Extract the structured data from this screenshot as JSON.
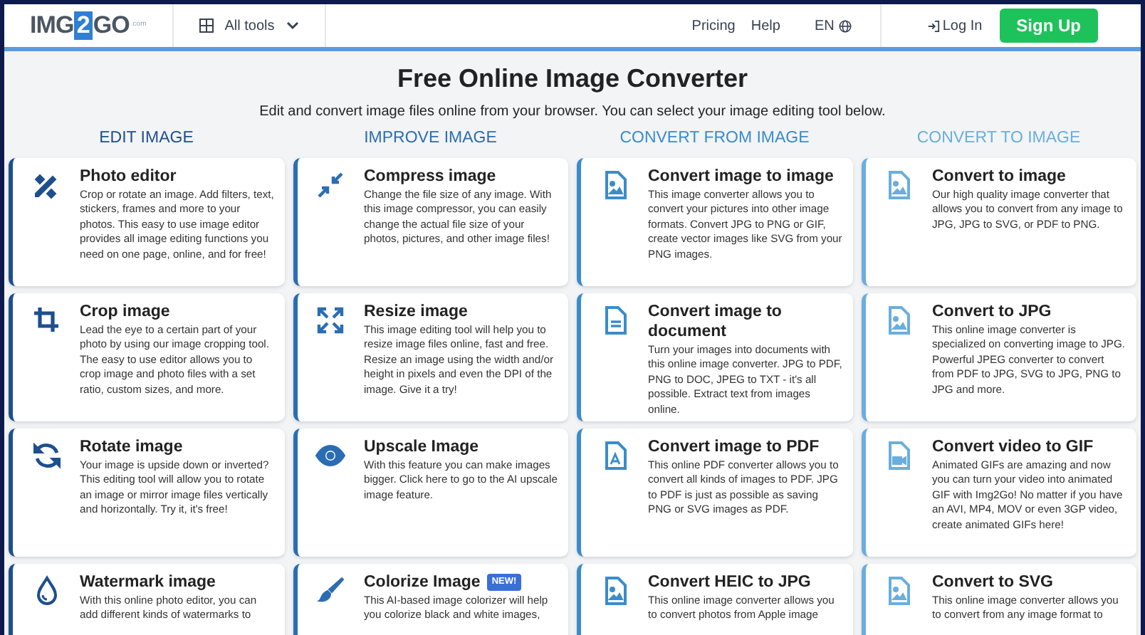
{
  "header": {
    "logo": {
      "left": "IMG",
      "digit": "2",
      "right": "GO",
      "suffix": ".com"
    },
    "all_tools": "All tools",
    "nav": [
      "Pricing",
      "Help"
    ],
    "language": "EN",
    "login": "Log In",
    "signup": "Sign Up"
  },
  "hero": {
    "title": "Free Online Image Converter",
    "subtitle": "Edit and convert image files online from your browser. You can select your image editing tool below."
  },
  "columns": [
    {
      "heading": "EDIT IMAGE",
      "color": "#1d4f8f",
      "tools": [
        {
          "title": "Photo editor",
          "description": "Crop or rotate an image. Add filters, text, stickers, frames and more to your photos. This easy to use image editor provides all image editing functions you need on one page, online, and for free!"
        },
        {
          "title": "Crop image",
          "description": "Lead the eye to a certain part of your photo by using our image cropping tool. The easy to use editor allows you to crop image and photo files with a set ratio, custom sizes, and more."
        },
        {
          "title": "Rotate image",
          "description": "Your image is upside down or inverted? This editing tool will allow you to rotate an image or mirror image files vertically and horizontally. Try it, it's free!"
        },
        {
          "title": "Watermark image",
          "description": "With this online photo editor, you can add different kinds of watermarks to"
        }
      ]
    },
    {
      "heading": "IMPROVE IMAGE",
      "color": "#2b6db3",
      "tools": [
        {
          "title": "Compress image",
          "description": "Change the file size of any image. With this image compressor, you can easily change the actual file size of your photos, pictures, and other image files!"
        },
        {
          "title": "Resize image",
          "description": "This image editing tool will help you to resize image files online, fast and free. Resize an image using the width and/or height in pixels and even the DPI of the image. Give it a try!"
        },
        {
          "title": "Upscale Image",
          "description": "With this feature you can make images bigger. Click here to go to the AI upscale image feature."
        },
        {
          "title": "Colorize Image",
          "badge": "NEW!",
          "description": "This AI-based image colorizer will help you colorize black and white images,"
        }
      ]
    },
    {
      "heading": "CONVERT FROM IMAGE",
      "color": "#3a8ccc",
      "tools": [
        {
          "title": "Convert image to image",
          "description": "This image converter allows you to convert your pictures into other image formats. Convert JPG to PNG or GIF, create vector images like SVG from your PNG images."
        },
        {
          "title": "Convert image to document",
          "description": "Turn your images into documents with this online image converter. JPG to PDF, PNG to DOC, JPEG to TXT - it's all possible. Extract text from images online."
        },
        {
          "title": "Convert image to PDF",
          "description": "This online PDF converter allows you to convert all kinds of images to PDF. JPG to PDF is just as possible as saving PNG or SVG images as PDF."
        },
        {
          "title": "Convert HEIC to JPG",
          "description": "This online image converter allows you to convert photos from Apple image"
        }
      ]
    },
    {
      "heading": "CONVERT TO IMAGE",
      "color": "#6aaedd",
      "tools": [
        {
          "title": "Convert to image",
          "description": "Our high quality image converter that allows you to convert from any image to JPG, JPG to SVG, or PDF to PNG."
        },
        {
          "title": "Convert to JPG",
          "description": "This online image converter is specialized on converting image to JPG. Powerful JPEG converter to convert from PDF to JPG, SVG to JPG, PNG to JPG and more."
        },
        {
          "title": "Convert video to GIF",
          "description": "Animated GIFs are amazing and now you can turn your video into animated GIF with Img2Go! No matter if you have an AVI, MP4, MOV or even 3GP video, create animated GIFs here!"
        },
        {
          "title": "Convert to SVG",
          "description": "This online image converter allows you to convert from any image format to"
        }
      ]
    }
  ]
}
